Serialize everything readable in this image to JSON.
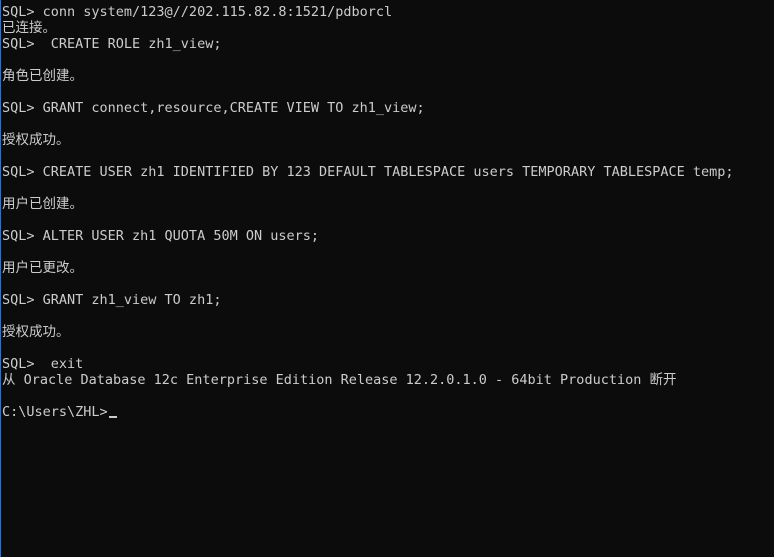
{
  "console": {
    "lines": [
      "SQL> conn system/123@//202.115.82.8:1521/pdborcl",
      "已连接。",
      "SQL>  CREATE ROLE zh1_view;",
      "",
      "角色已创建。",
      "",
      "SQL> GRANT connect,resource,CREATE VIEW TO zh1_view;",
      "",
      "授权成功。",
      "",
      "SQL> CREATE USER zh1 IDENTIFIED BY 123 DEFAULT TABLESPACE users TEMPORARY TABLESPACE temp;",
      "",
      "用户已创建。",
      "",
      "SQL> ALTER USER zh1 QUOTA 50M ON users;",
      "",
      "用户已更改。",
      "",
      "SQL> GRANT zh1_view TO zh1;",
      "",
      "授权成功。",
      "",
      "SQL>  exit",
      "从 Oracle Database 12c Enterprise Edition Release 12.2.0.1.0 - 64bit Production 断开",
      "",
      "C:\\Users\\ZHL>"
    ]
  }
}
